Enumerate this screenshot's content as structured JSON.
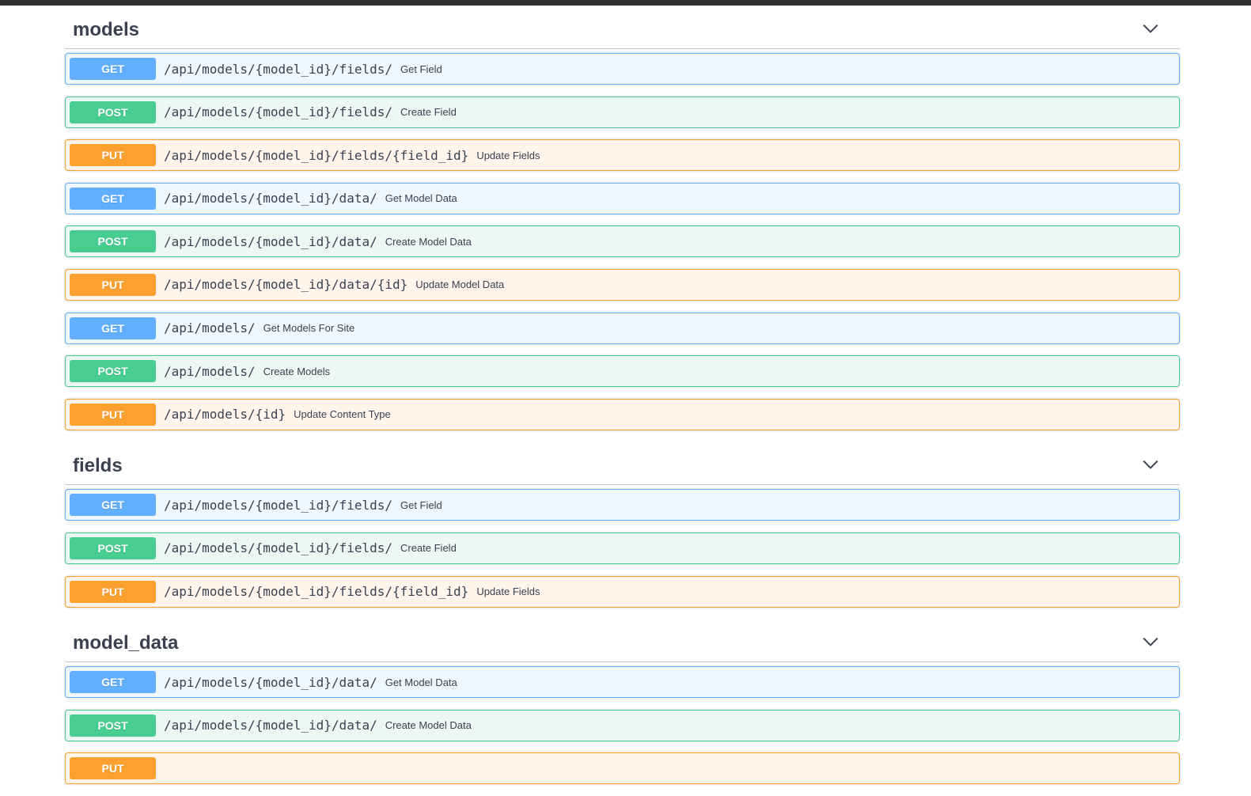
{
  "colors": {
    "get": "#61affe",
    "post": "#49cc90",
    "put": "#fca130",
    "text": "#3b4151",
    "topbar": "#2f2f2f"
  },
  "sections": [
    {
      "title": "models",
      "icon": "chevron-down-icon",
      "operations": [
        {
          "method": "GET",
          "path": "/api/models/{model_id}/fields/",
          "summary": "Get Field"
        },
        {
          "method": "POST",
          "path": "/api/models/{model_id}/fields/",
          "summary": "Create Field"
        },
        {
          "method": "PUT",
          "path": "/api/models/{model_id}/fields/{field_id}",
          "summary": "Update Fields"
        },
        {
          "method": "GET",
          "path": "/api/models/{model_id}/data/",
          "summary": "Get Model Data"
        },
        {
          "method": "POST",
          "path": "/api/models/{model_id}/data/",
          "summary": "Create Model Data"
        },
        {
          "method": "PUT",
          "path": "/api/models/{model_id}/data/{id}",
          "summary": "Update Model Data"
        },
        {
          "method": "GET",
          "path": "/api/models/",
          "summary": "Get Models For Site"
        },
        {
          "method": "POST",
          "path": "/api/models/",
          "summary": "Create Models"
        },
        {
          "method": "PUT",
          "path": "/api/models/{id}",
          "summary": "Update Content Type"
        }
      ]
    },
    {
      "title": "fields",
      "icon": "chevron-down-icon",
      "operations": [
        {
          "method": "GET",
          "path": "/api/models/{model_id}/fields/",
          "summary": "Get Field"
        },
        {
          "method": "POST",
          "path": "/api/models/{model_id}/fields/",
          "summary": "Create Field"
        },
        {
          "method": "PUT",
          "path": "/api/models/{model_id}/fields/{field_id}",
          "summary": "Update Fields"
        }
      ]
    },
    {
      "title": "model_data",
      "icon": "chevron-down-icon",
      "operations": [
        {
          "method": "GET",
          "path": "/api/models/{model_id}/data/",
          "summary": "Get Model Data"
        },
        {
          "method": "POST",
          "path": "/api/models/{model_id}/data/",
          "summary": "Create Model Data"
        },
        {
          "method": "PUT",
          "path": "",
          "summary": ""
        }
      ]
    }
  ]
}
